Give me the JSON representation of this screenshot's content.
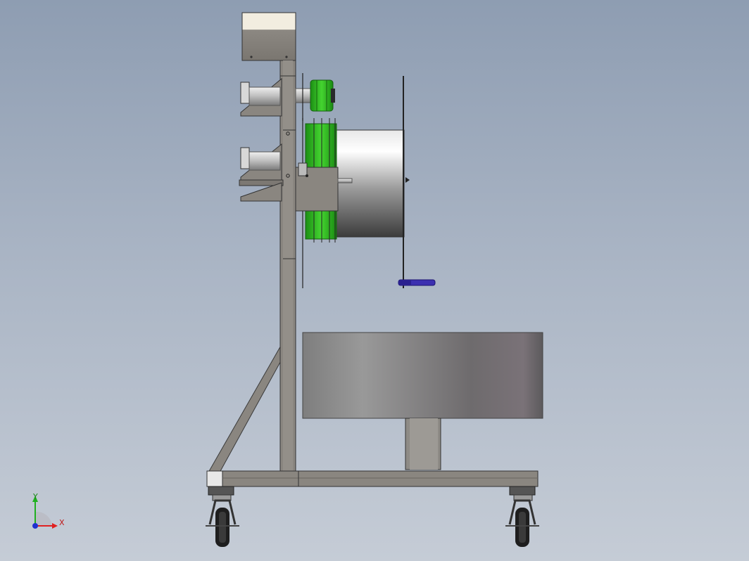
{
  "viewport": {
    "background_top": "#8e9db2",
    "background_bottom": "#c5ccd6"
  },
  "model": {
    "frame_color": "#8a8680",
    "spool_color": "#2fbf1f",
    "handle_color": "#3b2fb0",
    "drum_color": "#8c8c8c"
  },
  "triad": {
    "x_label": "X",
    "y_label": "Y",
    "x_color": "#e02020",
    "y_color": "#20b020",
    "z_color": "#2030d0"
  }
}
